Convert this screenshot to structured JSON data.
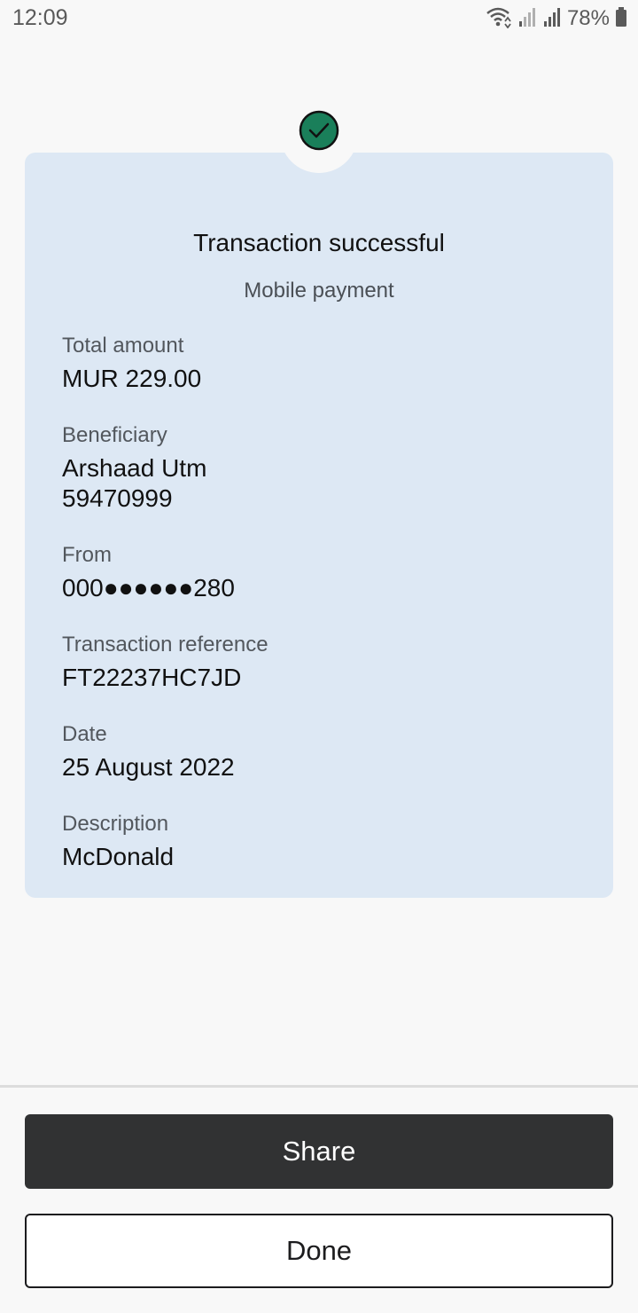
{
  "status_bar": {
    "time": "12:09",
    "battery_text": "78%",
    "icons": [
      "wifi-icon",
      "signal-icon",
      "signal-icon",
      "battery-icon"
    ]
  },
  "receipt": {
    "status_icon": "check-circle-icon",
    "accent_color": "#1a7f5a",
    "title": "Transaction successful",
    "subtitle": "Mobile payment",
    "fields": [
      {
        "label": "Total amount",
        "values": [
          "MUR 229.00"
        ]
      },
      {
        "label": "Beneficiary",
        "values": [
          "Arshaad Utm",
          "59470999"
        ]
      },
      {
        "label": "From",
        "values": [
          "000●●●●●●280"
        ]
      },
      {
        "label": "Transaction reference",
        "values": [
          "FT22237HC7JD"
        ]
      },
      {
        "label": "Date",
        "values": [
          "25 August 2022"
        ]
      },
      {
        "label": "Description",
        "values": [
          "McDonald"
        ]
      }
    ]
  },
  "actions": {
    "share_label": "Share",
    "done_label": "Done"
  }
}
